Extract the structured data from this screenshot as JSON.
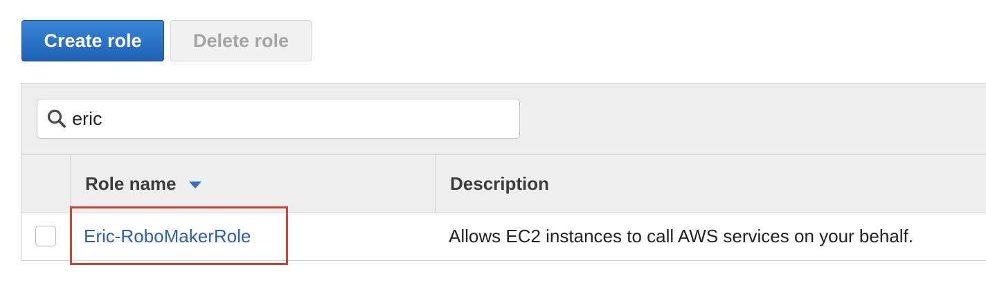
{
  "toolbar": {
    "create_label": "Create role",
    "delete_label": "Delete role"
  },
  "search": {
    "value": "eric",
    "icon": "search-icon"
  },
  "table": {
    "columns": [
      {
        "label": "Role name",
        "sort_icon": "sort-descending-icon"
      },
      {
        "label": "Description"
      }
    ],
    "rows": [
      {
        "role_name": "Eric-RoboMakerRole",
        "description": "Allows EC2 instances to call AWS services on your behalf."
      }
    ]
  },
  "colors": {
    "primary_button": "#1d61b6",
    "link": "#2a5fb3",
    "highlight": "#d7412a",
    "header_background": "#eeeeee"
  }
}
